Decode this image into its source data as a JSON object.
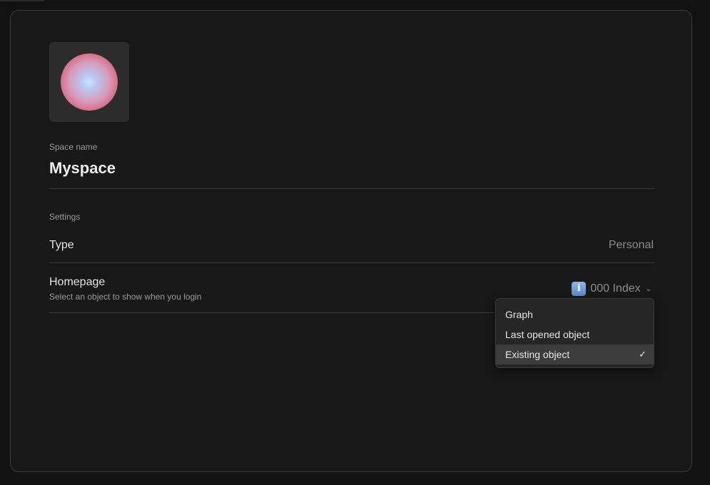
{
  "space": {
    "name_label": "Space name",
    "name": "Myspace"
  },
  "settings": {
    "section_label": "Settings",
    "type": {
      "title": "Type",
      "value": "Personal"
    },
    "homepage": {
      "title": "Homepage",
      "description": "Select an object to show when you login",
      "selected_icon": "info-icon",
      "selected_icon_glyph": "i",
      "selected_value": "000 Index",
      "chevron": "⌄"
    }
  },
  "dropdown": {
    "options": [
      {
        "label": "Graph"
      },
      {
        "label": "Last opened object"
      },
      {
        "label": "Existing object",
        "selected": true
      }
    ],
    "check_glyph": "✓"
  },
  "colors": {
    "background": "#181818",
    "border": "#3a3a3a",
    "text_primary": "#e6e6e6",
    "text_secondary": "#9a9a9a",
    "orb_outer": "#c8445f",
    "orb_inner": "#cfe4ff"
  }
}
